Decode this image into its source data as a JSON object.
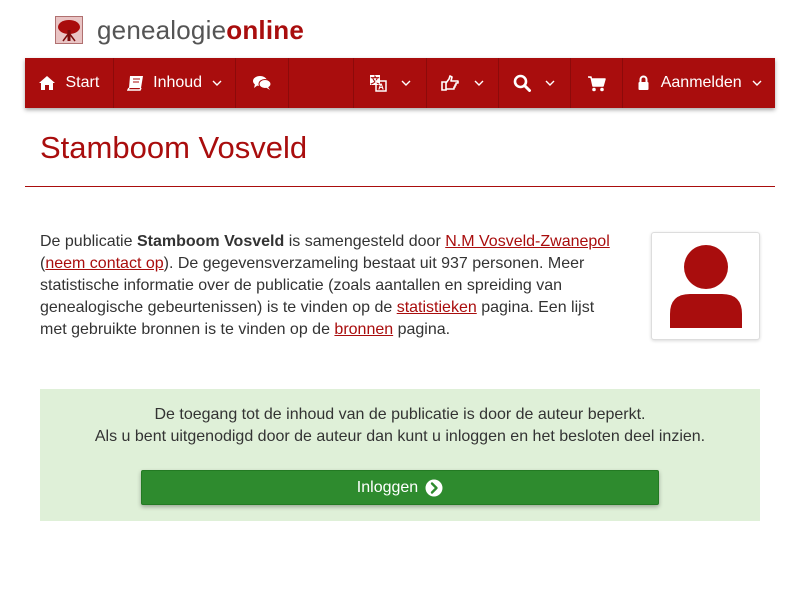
{
  "brand": {
    "part1": "genealogie",
    "part2": "online"
  },
  "navbar": {
    "start_label": "Start",
    "content_label": "Inhoud",
    "login_label": "Aanmelden",
    "icons": [
      "home-icon",
      "book-icon",
      "comments-icon",
      "translate-icon",
      "hand-pointer-icon",
      "search-icon",
      "shopping-cart-icon",
      "lock-icon"
    ]
  },
  "page": {
    "title": "Stamboom Vosveld"
  },
  "description": {
    "t1": "De publicatie ",
    "publication_name": "Stamboom Vosveld",
    "t2": " is samengesteld door ",
    "author_link": "N.M Vosveld-Zwanepol",
    "t3": " (",
    "contact_link": "neem contact op",
    "t4": "). De gegevensverzameling bestaat uit 937 personen. Meer statistische informatie over de publicatie (zoals aantallen en spreiding van genealogische gebeurtenissen) is te vinden op de ",
    "stats_link": "statistieken",
    "t5": " pagina. Een lijst met gebruikte bronnen is te vinden op de ",
    "sources_link": "bronnen",
    "t6": " pagina."
  },
  "notice": {
    "line1": "De toegang tot de inhoud van de publicatie is door de auteur beperkt.",
    "line2": "Als u bent uitgenodigd door de auteur dan kunt u inloggen en het besloten deel inzien.",
    "button_label": "Inloggen"
  },
  "colors": {
    "brand_red": "#a90d0d",
    "notice_bg": "#dff0d8",
    "button_green": "#2e8b2e"
  }
}
